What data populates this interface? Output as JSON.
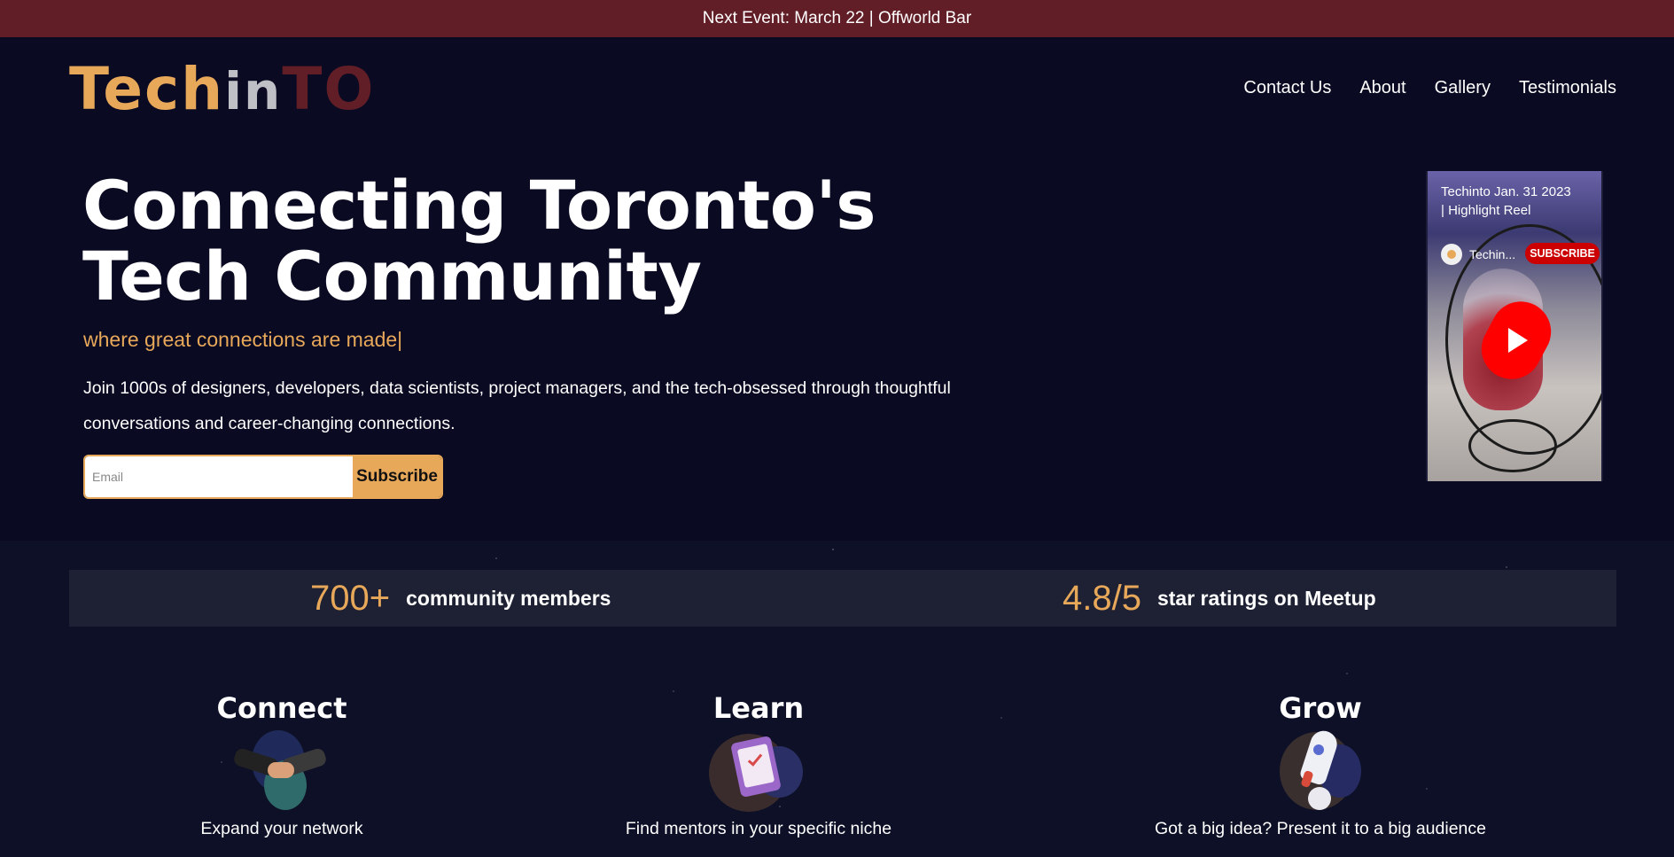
{
  "announcement": "Next Event: March 22 | Offworld Bar",
  "logo": {
    "part1": "Tech",
    "part2": "in",
    "part3": "TO"
  },
  "nav": [
    {
      "label": "Contact Us"
    },
    {
      "label": "About"
    },
    {
      "label": "Gallery"
    },
    {
      "label": "Testimonials"
    }
  ],
  "hero": {
    "title_line1": "Connecting Toronto's",
    "title_line2": "Tech Community",
    "tagline": "where great connections are made",
    "description": "Join 1000s of designers, developers, data scientists, project managers, and the tech-obsessed through thoughtful conversations and career-changing connections.",
    "email_placeholder": "Email",
    "subscribe_label": "Subscribe"
  },
  "video": {
    "title": "Techinto Jan. 31 2023 | Highlight Reel",
    "channel": "Techin...",
    "subscribe_label": "SUBSCRIBE",
    "icons": {
      "play": "youtube-shorts-play-icon"
    }
  },
  "stats": [
    {
      "value": "700+",
      "label": "community members"
    },
    {
      "value": "4.8/5",
      "label": "star ratings on Meetup"
    }
  ],
  "features": [
    {
      "heading": "Connect",
      "description": "Expand your network",
      "icon": "handshake-icon"
    },
    {
      "heading": "Learn",
      "description": "Find mentors in your specific niche",
      "icon": "clipboard-check-icon"
    },
    {
      "heading": "Grow",
      "description": "Got a big idea? Present it to a big audience",
      "icon": "rocket-icon"
    }
  ],
  "colors": {
    "announcement_bg": "#621e27",
    "page_bg": "#0a0a22",
    "accent": "#e8a85a",
    "stats_bg": "#1e2133"
  }
}
